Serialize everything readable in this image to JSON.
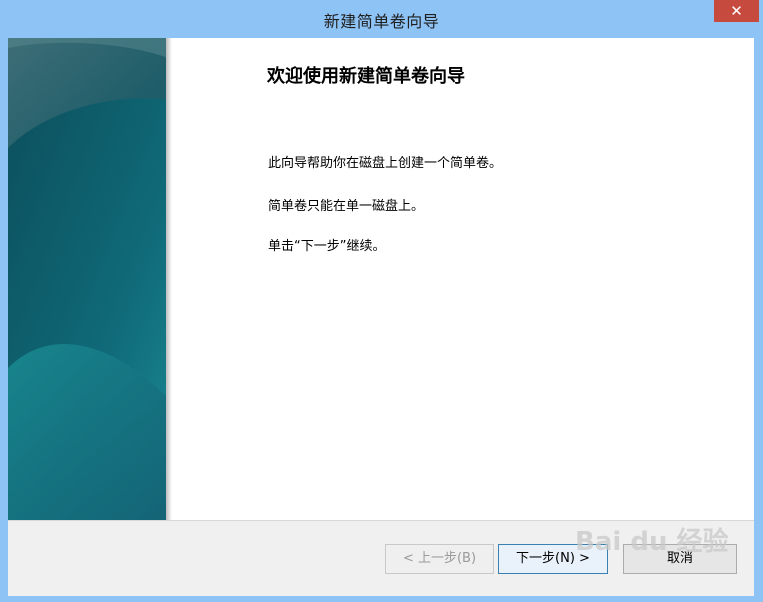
{
  "window": {
    "title": "新建简单卷向导",
    "close_label": "✕"
  },
  "content": {
    "heading": "欢迎使用新建简单卷向导",
    "paragraph1": "此向导帮助你在磁盘上创建一个简单卷。",
    "paragraph2": "简单卷只能在单一磁盘上。",
    "paragraph3": "单击“下一步”继续。"
  },
  "buttons": {
    "back": "< 上一步(B)",
    "next": "下一步(N) >",
    "cancel": "取消"
  },
  "watermark": {
    "text": "Bai du 经验"
  },
  "colors": {
    "titlebar": "#8ec3f5",
    "close": "#c74a3e",
    "sidebar_dark": "#0b5466",
    "sidebar_light": "#1a8d98"
  }
}
